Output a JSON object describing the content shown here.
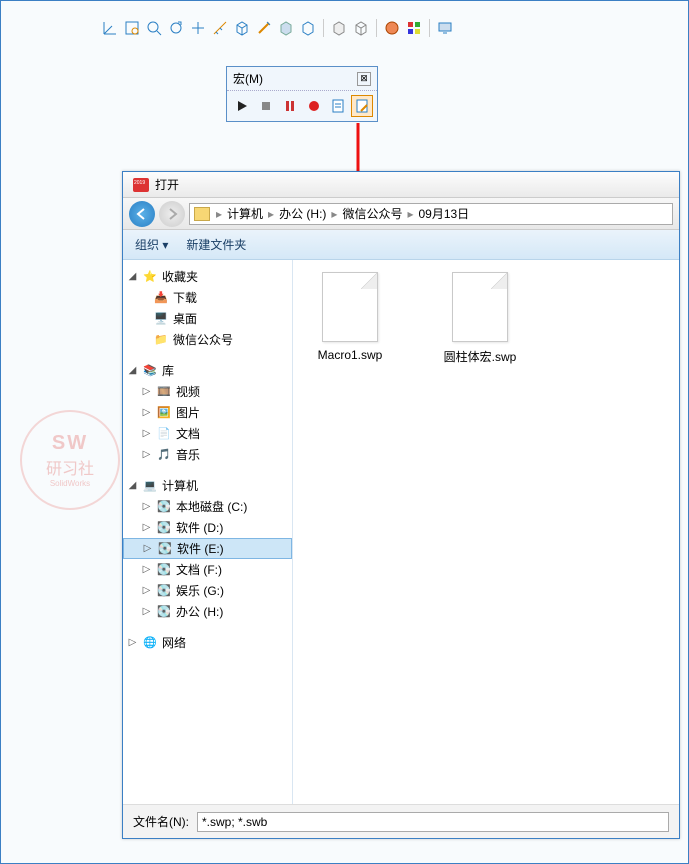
{
  "macro_panel": {
    "title": "宏(M)"
  },
  "dialog": {
    "title": "打开",
    "breadcrumbs": [
      "计算机",
      "办公 (H:)",
      "微信公众号",
      "09月13日"
    ],
    "cmd": {
      "organize": "组织 ▾",
      "newfolder": "新建文件夹"
    },
    "filename_label": "文件名(N):",
    "filter": "*.swp; *.swb"
  },
  "tree": {
    "favorites": {
      "label": "收藏夹",
      "items": [
        "下载",
        "桌面",
        "微信公众号"
      ]
    },
    "library": {
      "label": "库",
      "items": [
        "视频",
        "图片",
        "文档",
        "音乐"
      ]
    },
    "computer": {
      "label": "计算机",
      "items": [
        "本地磁盘 (C:)",
        "软件 (D:)",
        "软件 (E:)",
        "文档 (F:)",
        "娱乐 (G:)",
        "办公 (H:)"
      ]
    },
    "network": {
      "label": "网络"
    }
  },
  "files": [
    {
      "name": "Macro1.swp"
    },
    {
      "name": "圆柱体宏.swp"
    }
  ],
  "watermark": {
    "line1": "SW",
    "line2": "研习社",
    "line3": "SolidWorks"
  }
}
